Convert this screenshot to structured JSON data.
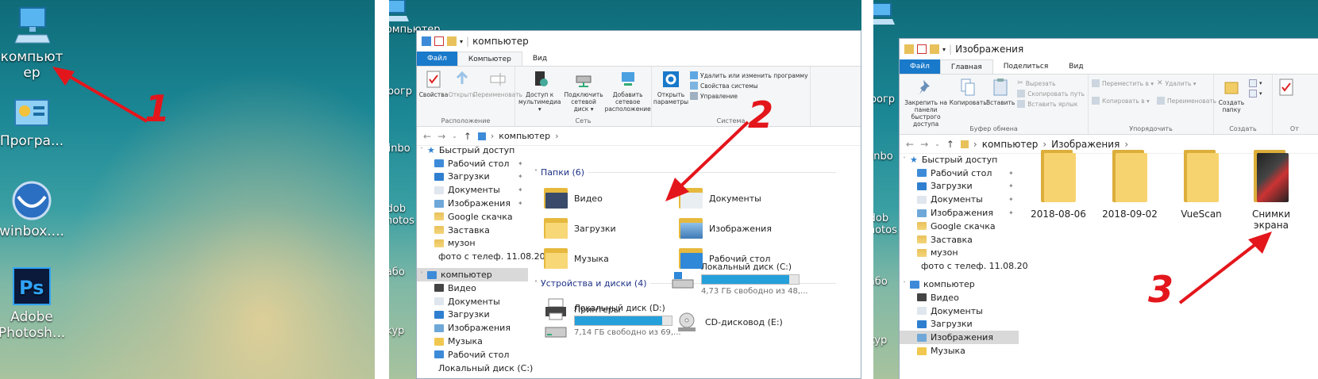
{
  "panel1": {
    "icons": [
      {
        "name": "computer",
        "label": "компьют\nер"
      },
      {
        "name": "programs",
        "label": "Програ..."
      },
      {
        "name": "winbox",
        "label": "winbox...."
      },
      {
        "name": "photoshop",
        "label": "Adobe\nPhotosh..."
      }
    ],
    "annotation": "1"
  },
  "panel2": {
    "partial_icons": [
      "Прогр",
      "winbo",
      "Adob Photos",
      "Рабо",
      "Skyp"
    ],
    "partial_top": "компьютер",
    "title": "компьютер",
    "tabs": [
      "Файл",
      "Компьютер",
      "Вид"
    ],
    "ribbon": {
      "location": {
        "label": "Расположение",
        "buttons": [
          "Свойства",
          "Открыть",
          "Переименовать"
        ]
      },
      "network": {
        "label": "Сеть",
        "buttons": [
          "Доступ к мультимедиа ▾",
          "Подключить сетевой диск ▾",
          "Добавить сетевое расположение"
        ]
      },
      "system": {
        "label": "Система",
        "open_params": "Открыть параметры",
        "small": [
          "Удалить или изменить программу",
          "Свойства системы",
          "Управление"
        ]
      }
    },
    "address": "компьютер",
    "nav": {
      "quick": "Быстрый доступ",
      "items": [
        "Рабочий стол",
        "Загрузки",
        "Документы",
        "Изображения",
        "Google скачка",
        "Заставка",
        "музон",
        "фото с телеф. 11.08.20"
      ],
      "computer": "компьютер",
      "computer_items": [
        "Видео",
        "Документы",
        "Загрузки",
        "Изображения",
        "Музыка",
        "Рабочий стол",
        "Локальный диск (C:)"
      ]
    },
    "folders_header": "Папки (6)",
    "folders": [
      "Видео",
      "Документы",
      "Загрузки",
      "Изображения",
      "Музыка",
      "Рабочий стол"
    ],
    "devices_header": "Устройства и диски (4)",
    "devices": [
      {
        "name": "Принтеры"
      },
      {
        "name": "Локальный диск (C:)",
        "free": "4,73 ГБ свободно из 48,...",
        "fill": 0.9
      },
      {
        "name": "Локальный диск (D:)",
        "free": "7,14 ГБ свободно из 69,...",
        "fill": 0.9
      },
      {
        "name": "CD-дисковод (E:)"
      }
    ],
    "annotation": "2"
  },
  "panel3": {
    "partial_icons": [
      "Прогр",
      "winbo",
      "Adob Photos",
      "Рабо",
      "Skyp"
    ],
    "title": "Изображения",
    "tabs": [
      "Файл",
      "Главная",
      "Поделиться",
      "Вид"
    ],
    "ribbon": {
      "clipboard": {
        "label": "Буфер обмена",
        "pin": "Закрепить на панели быстрого доступа",
        "copy": "Копировать",
        "paste": "Вставить",
        "small": [
          "Вырезать",
          "Скопировать путь",
          "Вставить ярлык"
        ]
      },
      "organize": {
        "label": "Упорядочить",
        "small": [
          "Переместить в ▾",
          "Копировать в ▾",
          "Удалить ▾",
          "Переименовать"
        ]
      },
      "create": {
        "label": "Создать",
        "new_folder": "Создать папку"
      },
      "open": {
        "label": "От"
      }
    },
    "address": [
      "компьютер",
      "Изображения"
    ],
    "nav": {
      "quick": "Быстрый доступ",
      "items": [
        "Рабочий стол",
        "Загрузки",
        "Документы",
        "Изображения",
        "Google скачка",
        "Заставка",
        "музон",
        "фото с телеф. 11.08.20"
      ],
      "computer": "компьютер",
      "computer_items": [
        "Видео",
        "Документы",
        "Загрузки",
        "Изображения",
        "Музыка"
      ]
    },
    "folders": [
      "2018-08-06",
      "2018-09-02",
      "VueScan",
      "Снимки\nэкрана"
    ],
    "annotation": "3"
  }
}
